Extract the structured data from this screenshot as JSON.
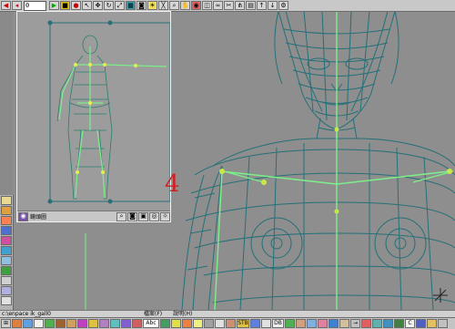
{
  "colors": {
    "mesh": "#1f6f78",
    "bones": "#7df08a",
    "viewport_bg": "#8e8e8e",
    "accent_red": "#d41e1e",
    "toolbar": "#c8c8c8"
  },
  "top_toolbar": {
    "frame_value": "0",
    "icons": [
      "play-back-icon",
      "stop-icon",
      "play-forward-icon",
      "key-icon",
      "select-icon",
      "move-icon",
      "rotate-icon",
      "scale-icon",
      "grid-icon",
      "camera-icon",
      "light-icon",
      "bone-icon",
      "zoom-icon",
      "pan-icon",
      "render-icon",
      "material-icon"
    ]
  },
  "left_toolbar": {
    "icons": [
      "layer-icon",
      "palette-icon",
      "texture-icon",
      "cube-icon",
      "sphere-icon",
      "landscape-icon",
      "cloud-icon",
      "tree-icon",
      "figure-icon",
      "joint-icon",
      "cross-icon",
      "plant-icon"
    ]
  },
  "inset": {
    "title": "鏡頭圖",
    "viewport_number": "4",
    "footer_icons": [
      "zoom-icon",
      "camera-icon",
      "film-icon",
      "render-icon",
      "light-icon"
    ]
  },
  "status_bar": {
    "path": "c:\\enpace ik_gall0",
    "item1": "檔案(F)",
    "item2": "說明(H)"
  },
  "bottom_toolbar": {
    "buttons": [
      "",
      "",
      "",
      "",
      "",
      "",
      "",
      "",
      "",
      "",
      "",
      "",
      "",
      "Abc",
      "",
      "",
      "",
      "",
      "",
      "",
      "",
      "STB",
      "",
      "",
      "DB",
      "",
      "",
      "",
      "",
      "",
      "",
      "",
      "",
      "",
      "",
      "",
      "",
      "",
      "",
      ""
    ]
  }
}
